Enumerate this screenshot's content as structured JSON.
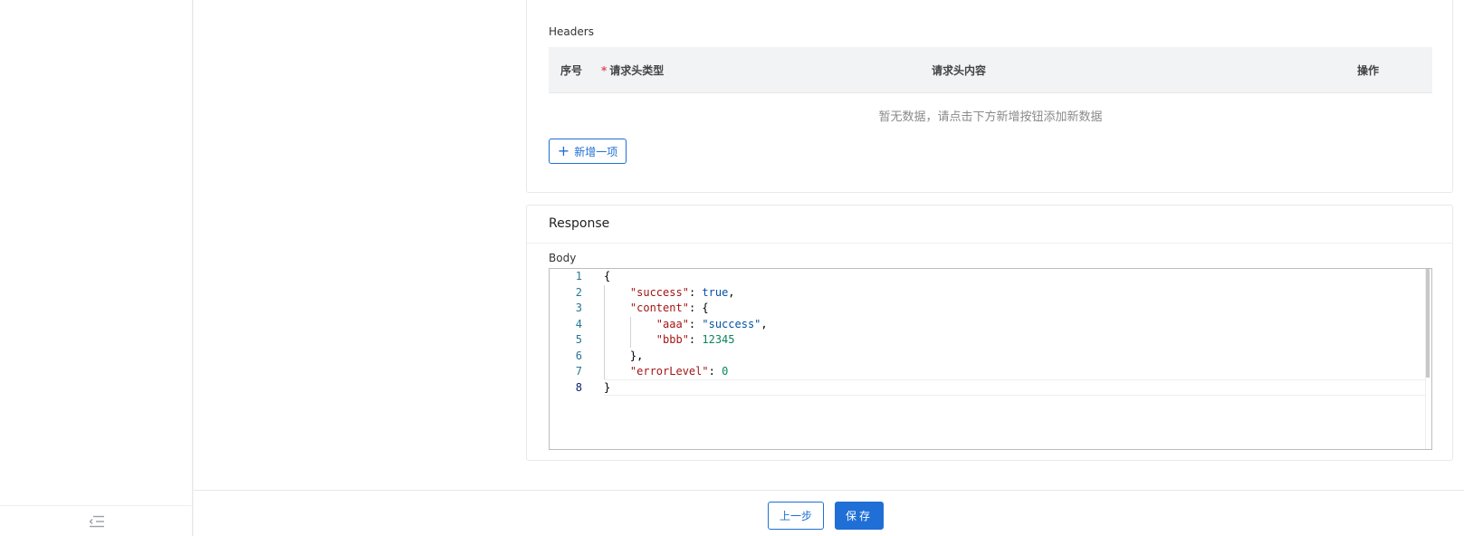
{
  "headers_section": {
    "label": "Headers",
    "table": {
      "columns": [
        "序号",
        "请求头类型",
        "请求头内容",
        "操作"
      ],
      "required_mark": "*",
      "empty_text": "暂无数据，请点击下方新增按钮添加新数据"
    },
    "add_button_label": "新增一项"
  },
  "response_section": {
    "title": "Response",
    "body_label": "Body",
    "editor": {
      "line_numbers": [
        "1",
        "2",
        "3",
        "4",
        "5",
        "6",
        "7",
        "8"
      ],
      "active_line": "8"
    }
  },
  "footer": {
    "prev_label": "上一步",
    "save_label": "保存"
  },
  "colors": {
    "primary": "#1f6fd6",
    "required": "#e34d59",
    "json_key": "#a31515",
    "json_string": "#0451a5",
    "json_number": "#098658"
  },
  "icons": {
    "sidebar_footer": "collapse-menu-icon",
    "add_button": "plus-icon"
  }
}
